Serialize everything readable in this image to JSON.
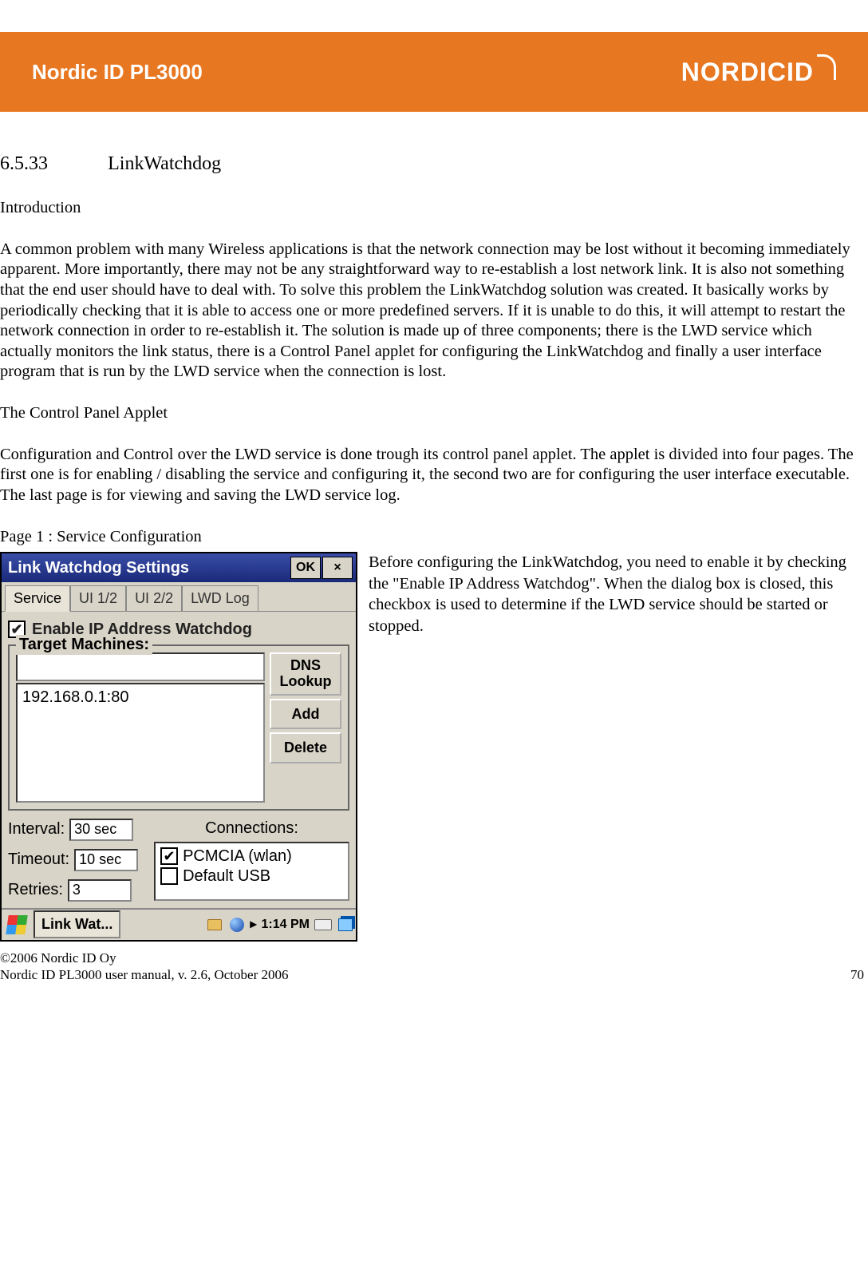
{
  "header": {
    "product": "Nordic ID PL3000",
    "brand": "NORDICID"
  },
  "section": {
    "number": "6.5.33",
    "title": "LinkWatchdog"
  },
  "intro_heading": "Introduction",
  "intro_body": "A common problem with many Wireless applications is that the network connection may be lost without it becoming immediately apparent. More importantly, there may not be any straightforward way to re-establish a lost network link. It is also not something that the end user should have to deal with. To solve this problem the LinkWatchdog solution was created. It basically works by periodically checking that it is able to access one or more predefined servers. If it is unable to do this, it will attempt to restart the network connection in order to re-establish it. The solution is made up of three components; there is the LWD service which actually monitors the link status, there is a Control Panel applet for configuring the LinkWatchdog and finally a user interface program that is run by the LWD service when the connection is lost.",
  "applet_heading": "The Control Panel Applet",
  "applet_body": "Configuration and Control over the LWD service is done trough its control panel applet. The applet is divided into four pages. The first one is for enabling / disabling the service and configuring it, the second two are for configuring the user interface executable. The last page is for viewing and saving the LWD service log.",
  "page1_heading": "Page 1 : Service Configuration",
  "figure_caption": "Before configuring the LinkWatchdog, you need to enable it by checking  the \"Enable IP Address Watchdog\". When the dialog box is closed, this checkbox is used to determine if the LWD service should be started or stopped.",
  "dialog": {
    "title": "Link Watchdog Settings",
    "ok": "OK",
    "close": "×",
    "tabs": [
      "Service",
      "UI 1/2",
      "UI 2/2",
      "LWD Log"
    ],
    "enable_label": "Enable IP Address Watchdog",
    "enable_checked": "✔",
    "target_legend": "Target Machines:",
    "host_input": "",
    "list_item": "192.168.0.1:80",
    "btn_dns": "DNS Lookup",
    "btn_add": "Add",
    "btn_delete": "Delete",
    "interval_label": "Interval:",
    "interval_value": "30 sec",
    "timeout_label": "Timeout:",
    "timeout_value": "10 sec",
    "retries_label": "Retries:",
    "retries_value": "3",
    "connections_label": "Connections:",
    "conn1": "PCMCIA (wlan)",
    "conn1_checked": "✔",
    "conn2": "Default USB",
    "taskbar_app": "Link Wat...",
    "tray_sep": "▸",
    "clock": "1:14 PM"
  },
  "footer": {
    "copyright": "©2006 Nordic ID Oy",
    "docline": "Nordic ID PL3000 user manual, v. 2.6, October 2006",
    "page": "70"
  }
}
